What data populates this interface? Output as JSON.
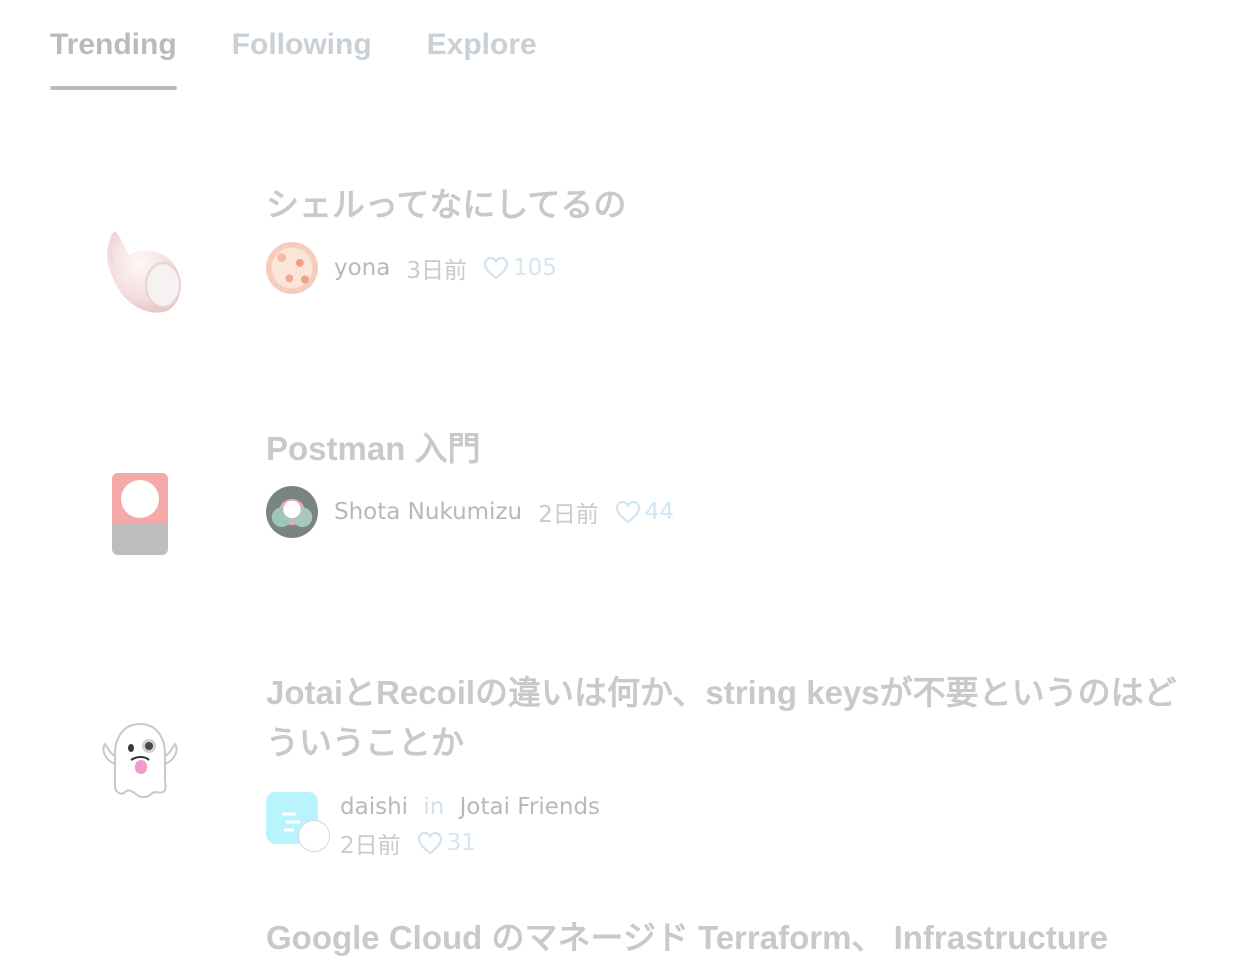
{
  "tabs": [
    {
      "label": "Trending",
      "active": true
    },
    {
      "label": "Following",
      "active": false
    },
    {
      "label": "Explore",
      "active": false
    }
  ],
  "articles": [
    {
      "emoji": "shell-emoji",
      "title": "シェルってなにしてるの",
      "author": "yona",
      "date": "3日前",
      "likes": "105"
    },
    {
      "emoji": "card-emoji",
      "title": "Postman 入門",
      "author": "Shota Nukumizu",
      "date": "2日前",
      "likes": "44"
    },
    {
      "emoji": "ghost-emoji",
      "title": "JotaiとRecoilの違いは何か、string keysが不要というのはどういうことか",
      "author": "daishi",
      "in": "in",
      "publication": "Jotai Friends",
      "date": "2日前",
      "likes": "31"
    },
    {
      "title": "Google Cloud のマネージド Terraform、 Infrastructure"
    }
  ]
}
